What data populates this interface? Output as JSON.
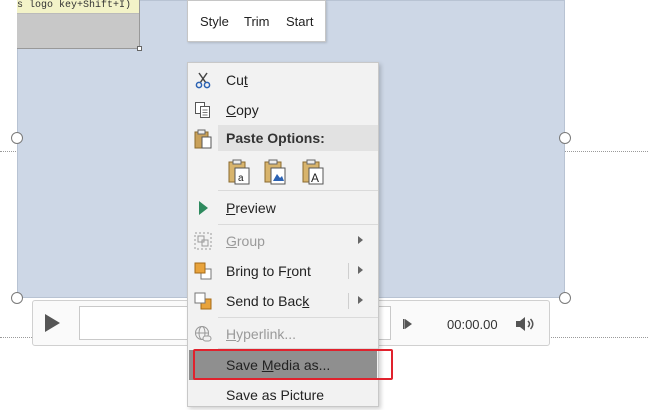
{
  "slide": {
    "thumbnail_caption": "s logo key+Shift+I)"
  },
  "mini_toolbar": {
    "style_label": "Style",
    "trim_label": "Trim",
    "start_label": "Start"
  },
  "player": {
    "time": "00:00.00"
  },
  "context_menu": {
    "cut": {
      "pre": "Cu",
      "key": "t",
      "post": ""
    },
    "copy": {
      "pre": "",
      "key": "C",
      "post": "opy"
    },
    "paste_options_label": "Paste Options:",
    "preview": {
      "pre": "",
      "key": "P",
      "post": "review"
    },
    "group": {
      "pre": "",
      "key": "G",
      "post": "roup"
    },
    "bring_to_front": {
      "pre": "Bring to F",
      "key": "r",
      "post": "ont"
    },
    "send_to_back": {
      "pre": "Send to Bac",
      "key": "k",
      "post": ""
    },
    "hyperlink": {
      "pre": "",
      "key": "H",
      "post": "yperlink..."
    },
    "save_media_as": {
      "pre": "Save ",
      "key": "M",
      "post": "edia as..."
    },
    "save_as_picture": {
      "pre": "Save as Picture",
      "key": "",
      "post": ""
    }
  },
  "colors": {
    "highlight_outline": "#e0222d",
    "media_fill": "#cdd7e6",
    "menu_bg": "#f2f2f2",
    "selected_item_bg": "#8f8f8f"
  },
  "icons": {
    "cut": "scissors-icon",
    "copy": "copy-icon",
    "paste": "clipboard-icon",
    "preview": "play-triangle-icon",
    "group": "group-icon",
    "bring_front": "bring-to-front-icon",
    "send_back": "send-to-back-icon",
    "hyperlink": "globe-link-icon"
  }
}
